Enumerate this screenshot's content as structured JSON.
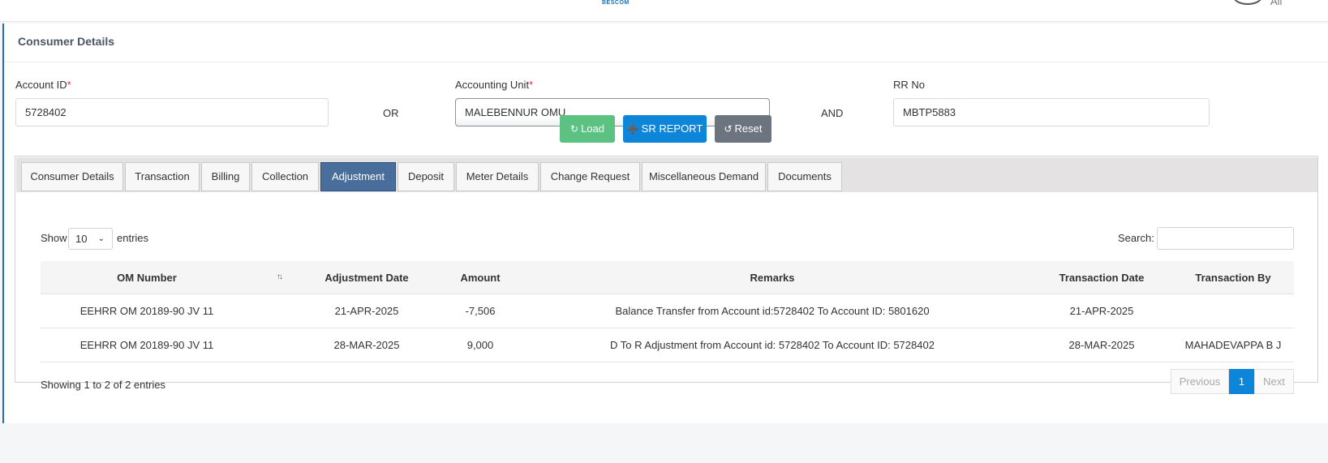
{
  "header": {
    "logo_text": "BESCOM",
    "user_initial": "All"
  },
  "page": {
    "title": "Consumer Details"
  },
  "form": {
    "account_id": {
      "label": "Account ID",
      "required_mark": "*",
      "value": "5728402"
    },
    "or_text": "OR",
    "accounting_unit": {
      "label": "Accounting Unit",
      "required_mark": "*",
      "value": "MALEBENNUR OMU"
    },
    "and_text": "AND",
    "rr_no": {
      "label": "RR No",
      "value": "MBTP5883"
    }
  },
  "buttons": {
    "load": "Load",
    "sr_report": "SR REPORT",
    "reset": "Reset"
  },
  "tabs": [
    "Consumer Details",
    "Transaction",
    "Billing",
    "Collection",
    "Adjustment",
    "Deposit",
    "Meter Details",
    "Change Request",
    "Miscellaneous Demand",
    "Documents"
  ],
  "active_tab": "Adjustment",
  "table": {
    "show_label": "Show",
    "page_size": "10",
    "entries_label": "entries",
    "search_label": "Search:",
    "search_value": "",
    "columns": [
      "OM Number",
      "Adjustment Date",
      "Amount",
      "Remarks",
      "Transaction Date",
      "Transaction By"
    ],
    "rows": [
      [
        "EEHRR OM 20189-90 JV 11",
        "21-APR-2025",
        "-7,506",
        "Balance Transfer from Account id:5728402 To Account ID: 5801620",
        "21-APR-2025",
        ""
      ],
      [
        "EEHRR OM 20189-90 JV 11",
        "28-MAR-2025",
        "9,000",
        "D To R Adjustment from Account id: 5728402 To Account ID: 5728402",
        "28-MAR-2025",
        "MAHADEVAPPA B J"
      ]
    ],
    "info": "Showing 1 to 2 of 2 entries",
    "pagination": {
      "previous": "Previous",
      "current": "1",
      "next": "Next"
    }
  },
  "colors": {
    "accent": "#0d85d8",
    "load": "#5cc281",
    "reset": "#6c7480",
    "active_tab": "#4a6e9c",
    "required": "#d9314a"
  }
}
